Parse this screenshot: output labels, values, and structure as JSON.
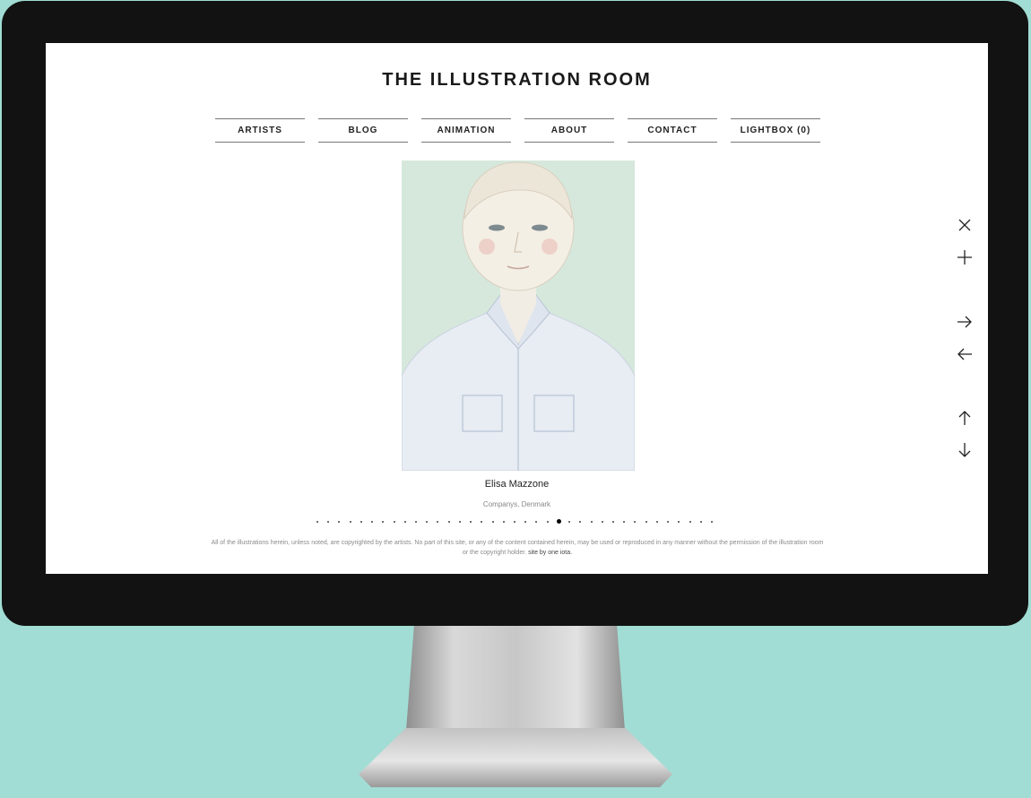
{
  "site": {
    "title": "THE ILLUSTRATION ROOM"
  },
  "nav": [
    {
      "label": "ARTISTS"
    },
    {
      "label": "BLOG"
    },
    {
      "label": "ANIMATION"
    },
    {
      "label": "ABOUT"
    },
    {
      "label": "CONTACT"
    },
    {
      "label": "LIGHTBOX (0)"
    }
  ],
  "artwork": {
    "artist": "Elisa Mazzone",
    "location": "Companys, Denmark"
  },
  "pager": {
    "total": 37,
    "current": 22
  },
  "footer": {
    "text": "All of the illustrations herein, unless noted, are copyrighted by the artists. No part of this site, or any of the content contained herein, may be used or reproduced in any manner without the permission of the illustration room or the copyright holder.",
    "credit": "site by one iota."
  },
  "controls": {
    "close": "close-icon",
    "add": "plus-icon",
    "next": "arrow-right-icon",
    "prev": "arrow-left-icon",
    "up": "arrow-up-icon",
    "down": "arrow-down-icon"
  },
  "colors": {
    "backdrop": "#a1ddd4",
    "bezel": "#121212",
    "artwork_bg": "#d6e8dc"
  }
}
